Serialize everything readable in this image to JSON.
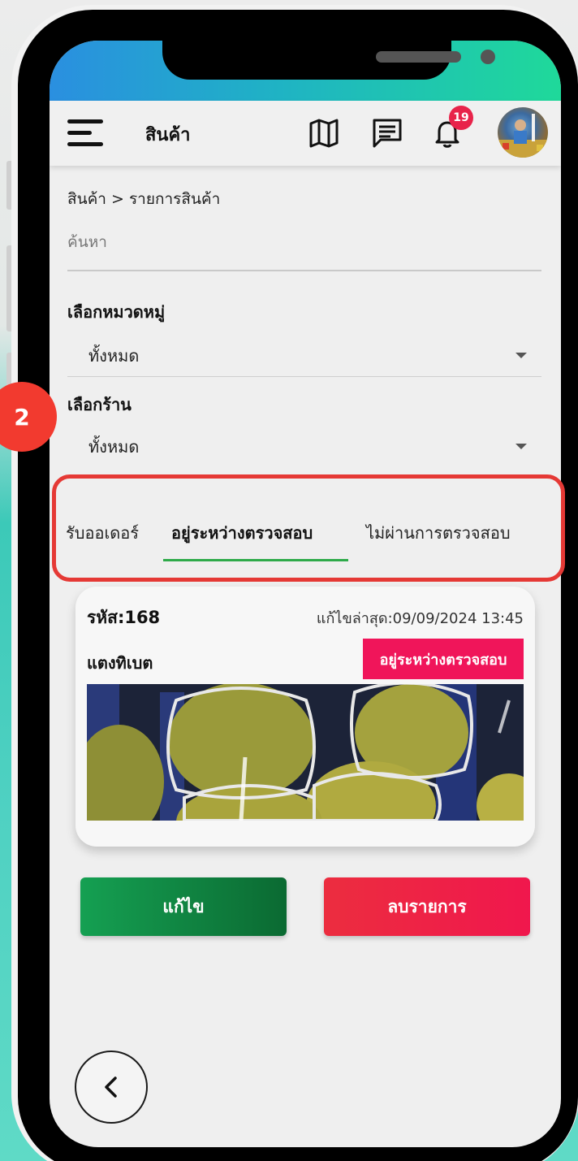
{
  "appbar": {
    "title": "สินค้า",
    "icons": [
      "menu-icon",
      "map-icon",
      "message-icon",
      "bell-icon"
    ],
    "notification_count": "19"
  },
  "breadcrumb": "สินค้า > รายการสินค้า",
  "search": {
    "placeholder": "ค้นหา",
    "value": ""
  },
  "category_filter": {
    "label": "เลือกหมวดหมู่",
    "value": "ทั้งหมด"
  },
  "shop_filter": {
    "label": "เลือกร้าน",
    "value": "ทั้งหมด"
  },
  "tabs": [
    {
      "label": "รับออเดอร์"
    },
    {
      "label": "อยู่ระหว่างตรวจสอบ",
      "active": true
    },
    {
      "label": "ไม่ผ่านการตรวจสอบ"
    }
  ],
  "product_card": {
    "code": "รหัส:168",
    "updated": "แก้ไขล่าสุด:09/09/2024 13:45",
    "name": "แตงทิเบต",
    "status": "อยู่ระหว่างตรวจสอบ"
  },
  "actions": {
    "edit_label": "แก้ไข",
    "delete_label": "ลบรายการ"
  },
  "step_marker": "2",
  "colors": {
    "accent_green": "#2eaa4a",
    "status_pink": "#f0155a",
    "highlight_red": "#e53935",
    "notification_red": "#e8234a"
  }
}
